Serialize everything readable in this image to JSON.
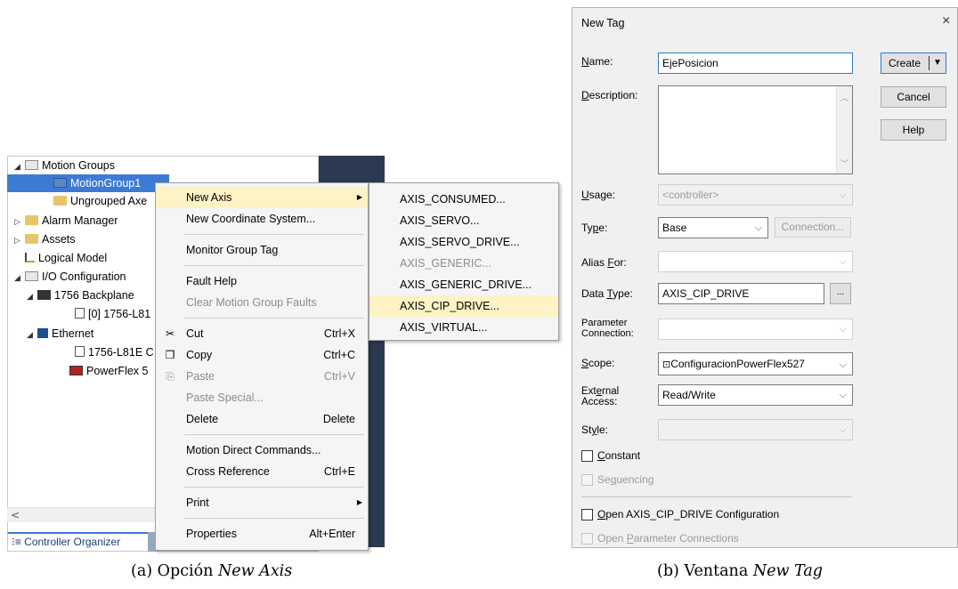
{
  "tree": {
    "items": [
      {
        "label": "Motion Groups"
      },
      {
        "label": "MotionGroup1"
      },
      {
        "label": "Ungrouped Axe"
      },
      {
        "label": "Alarm Manager"
      },
      {
        "label": "Assets"
      },
      {
        "label": "Logical Model"
      },
      {
        "label": "I/O Configuration"
      },
      {
        "label": "1756 Backplane"
      },
      {
        "label": "[0] 1756-L81"
      },
      {
        "label": "Ethernet"
      },
      {
        "label": "1756-L81E C"
      },
      {
        "label": "PowerFlex 5"
      }
    ],
    "organizer_tab": "Controller Organizer",
    "scroll_left": "<"
  },
  "context_menu": {
    "items": [
      {
        "label": "New Axis",
        "shortcut": ""
      },
      {
        "label": "New Coordinate System...",
        "shortcut": ""
      },
      {
        "label": "Monitor Group Tag",
        "shortcut": ""
      },
      {
        "label": "Fault Help",
        "shortcut": ""
      },
      {
        "label": "Clear Motion Group Faults",
        "shortcut": ""
      },
      {
        "label": "Cut",
        "shortcut": "Ctrl+X"
      },
      {
        "label": "Copy",
        "shortcut": "Ctrl+C"
      },
      {
        "label": "Paste",
        "shortcut": "Ctrl+V"
      },
      {
        "label": "Paste Special...",
        "shortcut": ""
      },
      {
        "label": "Delete",
        "shortcut": "Delete"
      },
      {
        "label": "Motion Direct Commands...",
        "shortcut": ""
      },
      {
        "label": "Cross Reference",
        "shortcut": "Ctrl+E"
      },
      {
        "label": "Print",
        "shortcut": ""
      },
      {
        "label": "Properties",
        "shortcut": "Alt+Enter"
      }
    ]
  },
  "submenu": {
    "items": [
      {
        "label": "AXIS_CONSUMED..."
      },
      {
        "label": "AXIS_SERVO..."
      },
      {
        "label": "AXIS_SERVO_DRIVE..."
      },
      {
        "label": "AXIS_GENERIC..."
      },
      {
        "label": "AXIS_GENERIC_DRIVE..."
      },
      {
        "label": "AXIS_CIP_DRIVE..."
      },
      {
        "label": "AXIS_VIRTUAL..."
      }
    ]
  },
  "captions": {
    "a_prefix": "(a) Opción ",
    "a_italic": "New Axis",
    "b_prefix": "(b) Ventana ",
    "b_italic": "New Tag"
  },
  "dialog": {
    "title": "New Tag",
    "close": "×",
    "labels": {
      "name_pre": "",
      "name_u": "N",
      "name_post": "ame:",
      "description_pre": "",
      "description_u": "D",
      "description_post": "escription:",
      "usage_pre": "",
      "usage_u": "U",
      "usage_post": "sage:",
      "type_pre": "Ty",
      "type_u": "p",
      "type_post": "e:",
      "alias_pre": "Alias ",
      "alias_u": "F",
      "alias_post": "or:",
      "datatype_pre": "Data ",
      "datatype_u": "T",
      "datatype_post": "ype:",
      "param_line1": "Parameter",
      "param_line2": "Connection:",
      "scope_pre": "",
      "scope_u": "S",
      "scope_post": "cope:",
      "ext_line1_pre": "Ext",
      "ext_line1_u": "e",
      "ext_line1_post": "rnal",
      "ext_line2": "Access:",
      "style_pre": "St",
      "style_u": "y",
      "style_post": "le:"
    },
    "values": {
      "name": "EjePosicion",
      "description": "",
      "usage": "<controller>",
      "type": "Base",
      "alias_for": "",
      "data_type": "AXIS_CIP_DRIVE",
      "parameter_connection": "",
      "scope": "ConfiguracionPowerFlex527",
      "external_access": "Read/Write",
      "style": ""
    },
    "buttons": {
      "create": "Create",
      "cancel": "Cancel",
      "help": "Help",
      "connection": "Connection...",
      "browse": "..."
    },
    "checkboxes": {
      "constant_pre": "",
      "constant_u": "C",
      "constant_post": "onstant",
      "sequencing_pre": "Se",
      "sequencing_u": "q",
      "sequencing_post": "uencing",
      "open_config_pre": "",
      "open_config_u": "O",
      "open_config_post": "pen AXIS_CIP_DRIVE Configuration",
      "open_param_pre": "Open ",
      "open_param_u": "P",
      "open_param_post": "arameter Connections"
    }
  }
}
